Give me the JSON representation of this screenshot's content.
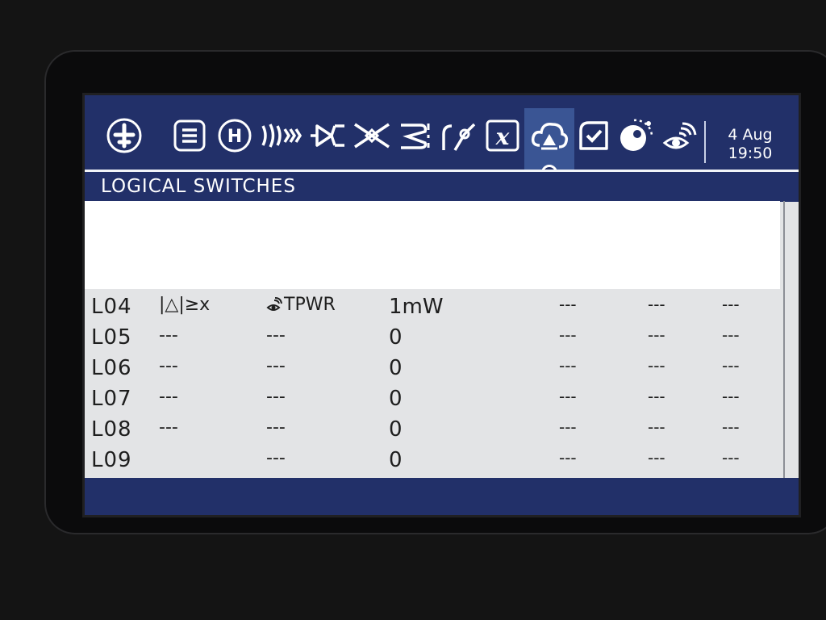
{
  "header": {
    "date": "4 Aug",
    "time": "19:50",
    "icons": [
      {
        "name": "model-select-icon",
        "active": false
      },
      {
        "name": "model-settings-icon",
        "active": false
      },
      {
        "name": "heli-setup-icon",
        "active": false
      },
      {
        "name": "flight-modes-icon",
        "active": false
      },
      {
        "name": "inputs-icon",
        "active": false
      },
      {
        "name": "mixes-icon",
        "active": false
      },
      {
        "name": "outputs-icon",
        "active": false
      },
      {
        "name": "curves-icon",
        "active": false
      },
      {
        "name": "global-variables-icon",
        "active": false
      },
      {
        "name": "logical-switches-icon",
        "active": true
      },
      {
        "name": "special-functions-icon",
        "active": false
      },
      {
        "name": "lua-scripts-icon",
        "active": false
      },
      {
        "name": "telemetry-icon",
        "active": false
      }
    ],
    "icon_labels": {
      "heli": "H",
      "gvars": "x"
    }
  },
  "page": {
    "title": "LOGICAL SWITCHES"
  },
  "logical_switches": [
    {
      "id": "L04",
      "func": "|△|≥x",
      "v1": "TPWR",
      "v1_has_icon": true,
      "v2": "1mW",
      "and": "---",
      "duration": "---",
      "delay": "---"
    },
    {
      "id": "L05",
      "func": "---",
      "v1": "---",
      "v1_has_icon": false,
      "v2": "0",
      "and": "---",
      "duration": "---",
      "delay": "---"
    },
    {
      "id": "L06",
      "func": "---",
      "v1": "---",
      "v1_has_icon": false,
      "v2": "0",
      "and": "---",
      "duration": "---",
      "delay": "---"
    },
    {
      "id": "L07",
      "func": "---",
      "v1": "---",
      "v1_has_icon": false,
      "v2": "0",
      "and": "---",
      "duration": "---",
      "delay": "---"
    },
    {
      "id": "L08",
      "func": "---",
      "v1": "---",
      "v1_has_icon": false,
      "v2": "0",
      "and": "---",
      "duration": "---",
      "delay": "---"
    },
    {
      "id": "L09",
      "func": "",
      "v1": "---",
      "v1_has_icon": false,
      "v2": "0",
      "and": "---",
      "duration": "---",
      "delay": "---"
    }
  ],
  "colors": {
    "header_bg": "#223069",
    "active_tab": "#3a5594",
    "screen_bg": "#e3e4e6",
    "text": "#1e1e1e"
  }
}
